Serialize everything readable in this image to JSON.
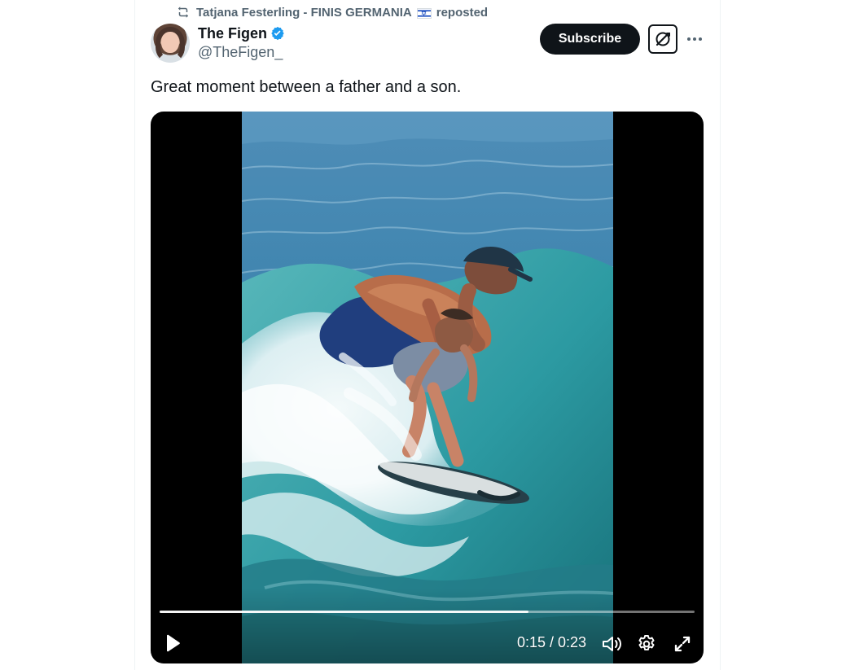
{
  "repost": {
    "icon": "repost-icon",
    "author": "Tatjana Festerling - FINIS GERMANIA",
    "flag_icon": "israel-flag-icon",
    "label": "reposted"
  },
  "author": {
    "avatar_icon": "profile-avatar",
    "display_name": "The Figen",
    "verified_icon": "verified-badge-icon",
    "handle": "@TheFigen_"
  },
  "actions": {
    "subscribe_label": "Subscribe",
    "grok_icon": "grok-icon",
    "more_icon": "more-icon"
  },
  "tweet": {
    "text": "Great moment between a father and a son."
  },
  "video": {
    "time": "0:15 / 0:23",
    "progress": 0.69,
    "play_icon": "play-icon",
    "volume_icon": "volume-icon",
    "settings_icon": "settings-icon",
    "fullscreen_icon": "fullscreen-icon"
  },
  "colors": {
    "primary_text": "#0f1419",
    "secondary_text": "#536471",
    "verified_blue": "#1d9bf0",
    "button_background": "#0f1419"
  }
}
